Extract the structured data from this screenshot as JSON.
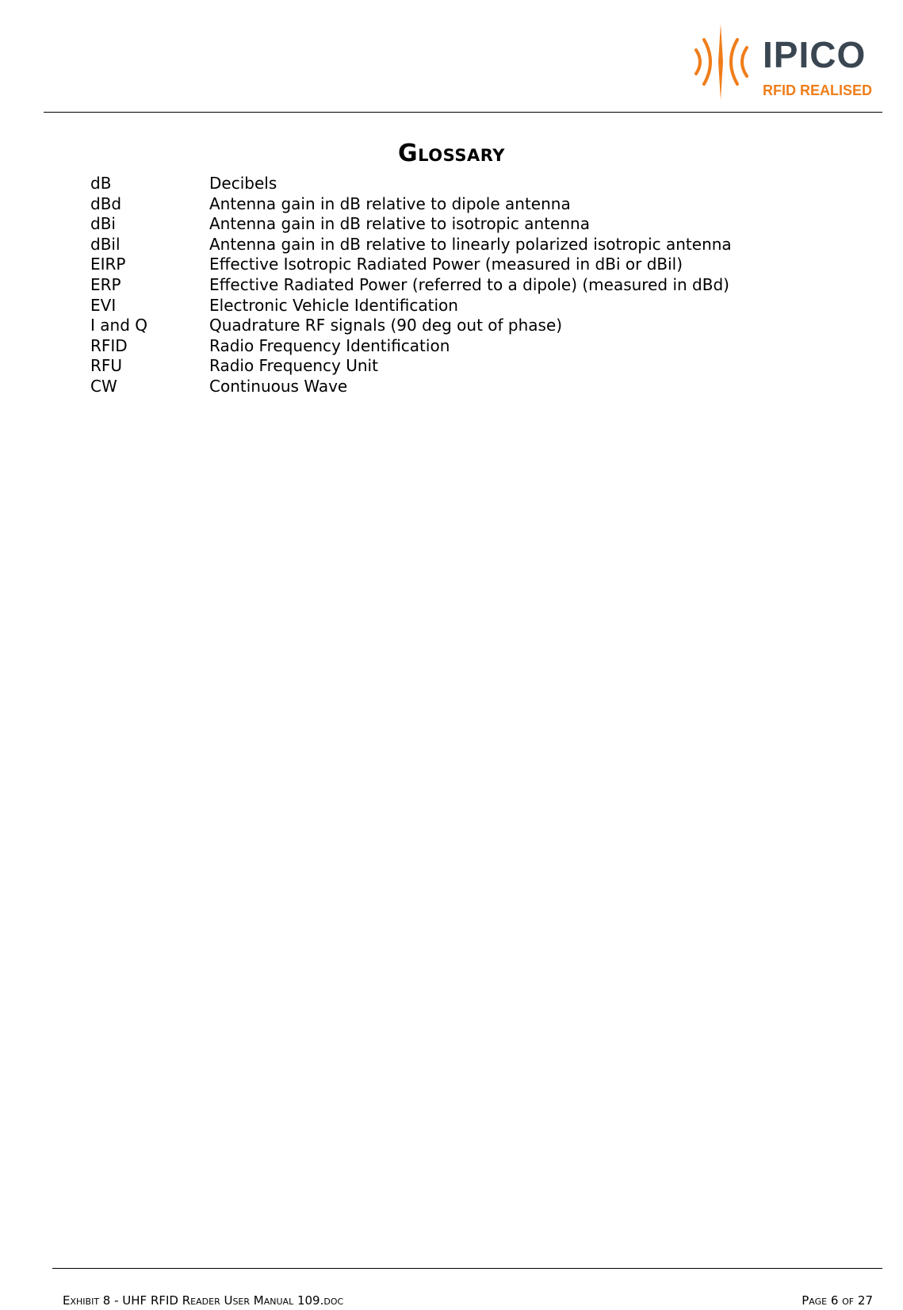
{
  "header": {
    "logo": {
      "wordmark": "IPICO",
      "tagline": "RFID REALISED",
      "colors": {
        "orange": "#f07d1a",
        "gray": "#3a4651"
      }
    }
  },
  "title": "Glossary",
  "glossary": [
    {
      "term": "dB",
      "definition": "Decibels"
    },
    {
      "term": "dBd",
      "definition": "Antenna gain in dB relative to dipole antenna"
    },
    {
      "term": "dBi",
      "definition": "Antenna gain in dB relative to isotropic antenna"
    },
    {
      "term": "dBil",
      "definition": "Antenna gain in dB relative to linearly polarized isotropic antenna"
    },
    {
      "term": "EIRP",
      "definition": "Effective Isotropic Radiated Power (measured in dBi or dBil)"
    },
    {
      "term": "ERP",
      "definition": "Effective Radiated Power (referred to a dipole) (measured in dBd)"
    },
    {
      "term": "EVI",
      "definition": "Electronic Vehicle Identification"
    },
    {
      "term": "I and Q",
      "definition": "Quadrature RF signals (90 deg out of phase)"
    },
    {
      "term": "RFID",
      "definition": "Radio Frequency Identification"
    },
    {
      "term": "RFU",
      "definition": "Radio Frequency Unit"
    },
    {
      "term": "CW",
      "definition": "Continuous Wave"
    }
  ],
  "footer": {
    "document": "Exhibit 8 - UHF RFID Reader User Manual 109.doc",
    "page": "Page 6 of 27"
  }
}
